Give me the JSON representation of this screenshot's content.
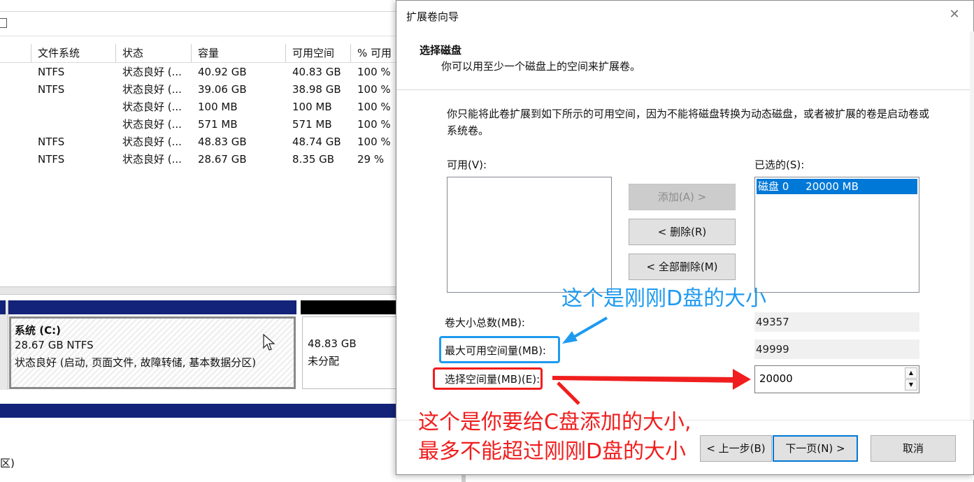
{
  "volume_table": {
    "columns": [
      "文件系统",
      "状态",
      "容量",
      "可用空间",
      "% 可用"
    ],
    "rows": [
      {
        "fs": "NTFS",
        "status": "状态良好 (...",
        "capacity": "40.92 GB",
        "free": "40.83 GB",
        "pct": "100 %"
      },
      {
        "fs": "NTFS",
        "status": "状态良好 (...",
        "capacity": "39.06 GB",
        "free": "38.98 GB",
        "pct": "100 %"
      },
      {
        "fs": "",
        "status": "状态良好 (...",
        "capacity": "100 MB",
        "free": "100 MB",
        "pct": "100 %"
      },
      {
        "fs": "",
        "status": "状态良好 (...",
        "capacity": "571 MB",
        "free": "571 MB",
        "pct": "100 %"
      },
      {
        "fs": "NTFS",
        "status": "状态良好 (...",
        "capacity": "48.83 GB",
        "free": "48.74 GB",
        "pct": "100 %"
      },
      {
        "fs": "NTFS",
        "status": "状态良好 (...",
        "capacity": "28.67 GB",
        "free": "8.35 GB",
        "pct": "29 %"
      }
    ]
  },
  "disk_map": {
    "partition_c": {
      "name": "系统 (C:)",
      "size": "28.67 GB NTFS",
      "status": "状态良好 (启动, 页面文件, 故障转储, 基本数据分区)"
    },
    "unallocated": {
      "size": "48.83 GB",
      "label": "未分配"
    },
    "cut_text": "区)"
  },
  "wizard": {
    "title": "扩展卷向导",
    "close_glyph": "✕",
    "header_title": "选择磁盘",
    "header_subtitle": "你可以用至少一个磁盘上的空间来扩展卷。",
    "description": "你只能将此卷扩展到如下所示的可用空间，因为不能将磁盘转换为动态磁盘，或者被扩展的卷是启动卷或系统卷。",
    "available_label": "可用(V):",
    "selected_label": "已选的(S):",
    "selected_items": [
      {
        "disk": "磁盘 0",
        "size": "20000 MB"
      }
    ],
    "add_button": "添加(A) >",
    "remove_button": "< 删除(R)",
    "remove_all_button": "< 全部删除(M)",
    "total_label": "卷大小总数(MB):",
    "total_value": "49357",
    "max_label": "最大可用空间量(MB):",
    "max_value": "49999",
    "select_label": "选择空间量(MB)(E):",
    "select_value": "20000",
    "back_button": "< 上一步(B)",
    "next_button": "下一页(N) >",
    "cancel_button": "取消"
  },
  "annotations": {
    "blue_text": "这个是刚刚D盘的大小",
    "red_line1": "这个是你要给C盘添加的大小,",
    "red_line2": "最多不能超过刚刚D盘的大小",
    "blue_color": "#1e9af0",
    "red_color": "#f01e1e"
  },
  "colors": {
    "disk_bar": "#13237a",
    "selection": "#0078d7"
  }
}
